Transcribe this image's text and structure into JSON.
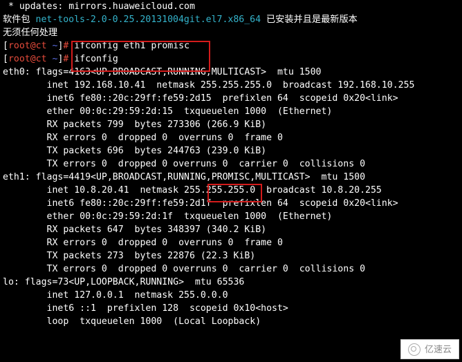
{
  "lines": [
    {
      "segments": [
        {
          "text": " * updates: mirrors.huaweicloud.com",
          "cls": ""
        }
      ]
    },
    {
      "segments": [
        {
          "text": "软件包 ",
          "cls": ""
        },
        {
          "text": "net-tools-2.0-0.25.20131004git.el7.x86_64",
          "cls": "cyan-pkg"
        },
        {
          "text": " 已安装并且是最新版本",
          "cls": ""
        }
      ]
    },
    {
      "segments": [
        {
          "text": "无须任何处理",
          "cls": ""
        }
      ]
    },
    {
      "segments": [
        {
          "text": "[",
          "cls": ""
        },
        {
          "text": "root@ct",
          "cls": "root"
        },
        {
          "text": " ",
          "cls": ""
        },
        {
          "text": "~",
          "cls": "tilde"
        },
        {
          "text": "]",
          "cls": ""
        },
        {
          "text": "#",
          "cls": "hash"
        },
        {
          "text": " ifconfig eth1 promisc",
          "cls": ""
        }
      ]
    },
    {
      "segments": [
        {
          "text": "[",
          "cls": ""
        },
        {
          "text": "root@ct",
          "cls": "root"
        },
        {
          "text": " ",
          "cls": ""
        },
        {
          "text": "~",
          "cls": "tilde"
        },
        {
          "text": "]",
          "cls": ""
        },
        {
          "text": "#",
          "cls": "hash"
        },
        {
          "text": " ifconfig",
          "cls": ""
        }
      ]
    },
    {
      "segments": [
        {
          "text": "eth0: flags=4163<UP,BROADCAST,RUNNING,MULTICAST>  mtu 1500",
          "cls": ""
        }
      ]
    },
    {
      "segments": [
        {
          "text": "        inet 192.168.10.41  netmask 255.255.255.0  broadcast 192.168.10.255",
          "cls": ""
        }
      ]
    },
    {
      "segments": [
        {
          "text": "        inet6 fe80::20c:29ff:fe59:2d15  prefixlen 64  scopeid 0x20<link>",
          "cls": ""
        }
      ]
    },
    {
      "segments": [
        {
          "text": "        ether 00:0c:29:59:2d:15  txqueuelen 1000  (Ethernet)",
          "cls": ""
        }
      ]
    },
    {
      "segments": [
        {
          "text": "        RX packets 799  bytes 273306 (266.9 KiB)",
          "cls": ""
        }
      ]
    },
    {
      "segments": [
        {
          "text": "        RX errors 0  dropped 0  overruns 0  frame 0",
          "cls": ""
        }
      ]
    },
    {
      "segments": [
        {
          "text": "        TX packets 696  bytes 244763 (239.0 KiB)",
          "cls": ""
        }
      ]
    },
    {
      "segments": [
        {
          "text": "        TX errors 0  dropped 0 overruns 0  carrier 0  collisions 0",
          "cls": ""
        }
      ]
    },
    {
      "segments": [
        {
          "text": "",
          "cls": ""
        }
      ]
    },
    {
      "segments": [
        {
          "text": "eth1: flags=4419<UP,BROADCAST,RUNNING,PROMISC,MULTICAST>  mtu 1500",
          "cls": ""
        }
      ]
    },
    {
      "segments": [
        {
          "text": "        inet 10.8.20.41  netmask 255.255.255.0  broadcast 10.8.20.255",
          "cls": ""
        }
      ]
    },
    {
      "segments": [
        {
          "text": "        inet6 fe80::20c:29ff:fe59:2d1f  prefixlen 64  scopeid 0x20<link>",
          "cls": ""
        }
      ]
    },
    {
      "segments": [
        {
          "text": "        ether 00:0c:29:59:2d:1f  txqueuelen 1000  (Ethernet)",
          "cls": ""
        }
      ]
    },
    {
      "segments": [
        {
          "text": "        RX packets 647  bytes 348397 (340.2 KiB)",
          "cls": ""
        }
      ]
    },
    {
      "segments": [
        {
          "text": "        RX errors 0  dropped 0  overruns 0  frame 0",
          "cls": ""
        }
      ]
    },
    {
      "segments": [
        {
          "text": "        TX packets 273  bytes 22876 (22.3 KiB)",
          "cls": ""
        }
      ]
    },
    {
      "segments": [
        {
          "text": "        TX errors 0  dropped 0 overruns 0  carrier 0  collisions 0",
          "cls": ""
        }
      ]
    },
    {
      "segments": [
        {
          "text": "",
          "cls": ""
        }
      ]
    },
    {
      "segments": [
        {
          "text": "lo: flags=73<UP,LOOPBACK,RUNNING>  mtu 65536",
          "cls": ""
        }
      ]
    },
    {
      "segments": [
        {
          "text": "        inet 127.0.0.1  netmask 255.0.0.0",
          "cls": ""
        }
      ]
    },
    {
      "segments": [
        {
          "text": "        inet6 ::1  prefixlen 128  scopeid 0x10<host>",
          "cls": ""
        }
      ]
    },
    {
      "segments": [
        {
          "text": "        loop  txqueuelen 1000  (Local Loopback)",
          "cls": ""
        }
      ]
    }
  ],
  "annotations": {
    "box1_label": "cmd-highlight-ifconfig",
    "box2_label": "promisc-flag-highlight"
  },
  "watermark": "亿速云"
}
